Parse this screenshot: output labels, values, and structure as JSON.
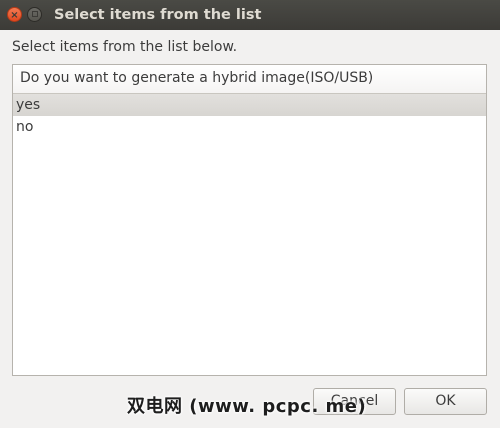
{
  "window": {
    "title": "Select items from the list",
    "close_glyph": "×",
    "buttons": [
      "close-icon",
      "maximize-icon"
    ]
  },
  "dialog": {
    "prompt": "Select items from the list below.",
    "column_header": "Do you want to generate a hybrid image(ISO/USB)",
    "items": [
      {
        "label": "yes",
        "selected": true
      },
      {
        "label": "no",
        "selected": false
      }
    ],
    "cancel_label": "Cancel",
    "ok_label": "OK"
  },
  "watermark": "双电网 (www. pcpc. me)",
  "colors": {
    "titlebar": "#3c3b37",
    "close_button": "#e95420",
    "selection": "#d9d7d3"
  }
}
